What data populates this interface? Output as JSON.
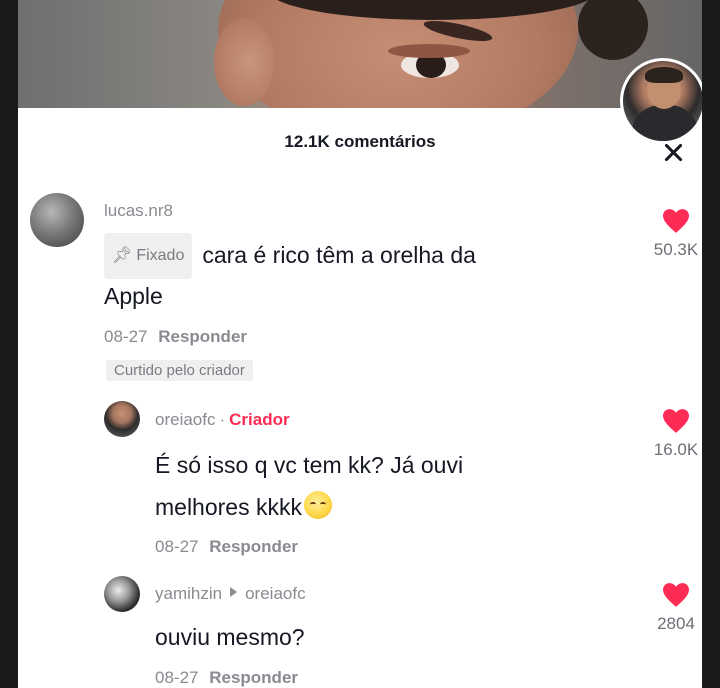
{
  "header": {
    "comment_count": "12.1K comentários"
  },
  "icons": {
    "close": "close-icon",
    "heart": "heart-icon",
    "pin": "pin-icon",
    "reply_arrow": "reply-arrow-icon"
  },
  "colors": {
    "accent": "#fe2c55",
    "muted": "#8a8b91",
    "text": "#161823"
  },
  "comments": [
    {
      "username": "lucas.nr8",
      "pinned_label": "Fixado",
      "text_line1": "cara é rico têm a orelha da",
      "text_line2": "Apple",
      "date": "08-27",
      "reply_label": "Responder",
      "liked_by_creator": "Curtido pelo criador",
      "likes": "50.3K"
    },
    {
      "username": "oreiaofc",
      "separator": "·",
      "creator_label": "Criador",
      "text_line1": "É só isso q vc tem kk? Já ouvi",
      "text_line2": "melhores kkkk",
      "date": "08-27",
      "reply_label": "Responder",
      "likes": "16.0K"
    },
    {
      "username": "yamihzin",
      "reply_to": "oreiaofc",
      "text_line1": "ouviu mesmo?",
      "date": "08-27",
      "reply_label": "Responder",
      "likes": "2804"
    }
  ]
}
